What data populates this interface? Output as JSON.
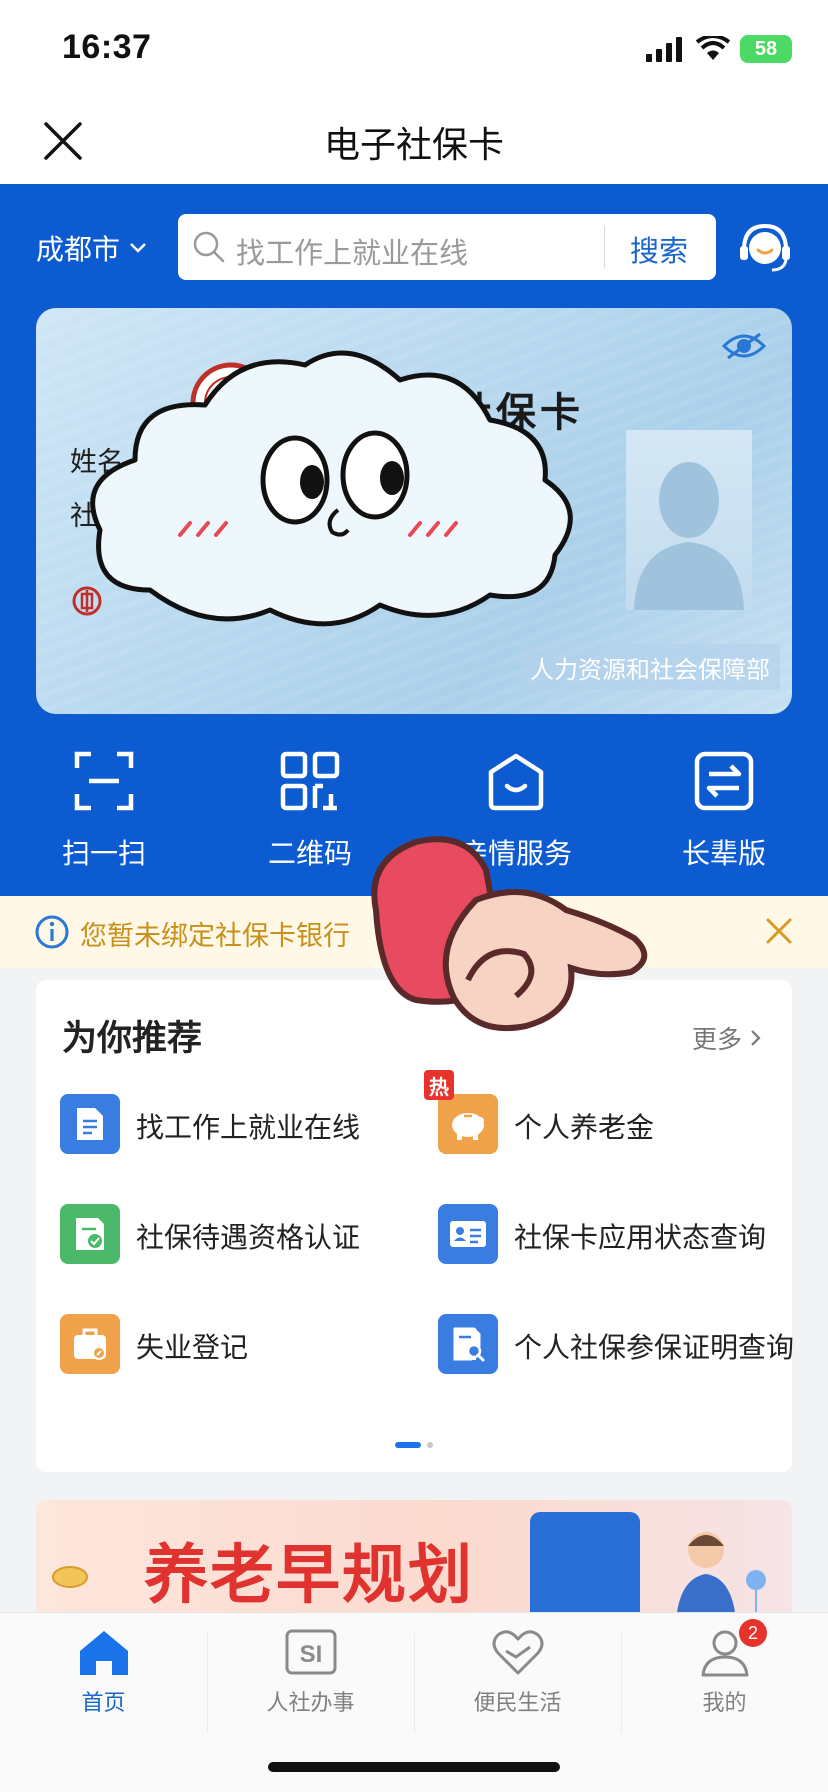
{
  "status_bar": {
    "time": "16:37",
    "battery": "58"
  },
  "nav": {
    "title": "电子社保卡",
    "close_icon": "close-icon"
  },
  "header": {
    "city": "成都市",
    "search": {
      "placeholder": "找工作上就业在线",
      "button": "搜索"
    },
    "service_icon": "customer-service-icon"
  },
  "card": {
    "title": "社保卡",
    "name_label": "姓名",
    "field2_label": "社会",
    "bank_label": "中国",
    "issuer": "人力资源和社会保障部"
  },
  "quick_actions": [
    {
      "label": "扫一扫",
      "icon": "scan-icon"
    },
    {
      "label": "二维码",
      "icon": "qrcode-icon"
    },
    {
      "label": "亲情服务",
      "icon": "family-service-icon"
    },
    {
      "label": "长辈版",
      "icon": "elder-mode-icon"
    }
  ],
  "notice": {
    "text": "您暂未绑定社保卡银行"
  },
  "recommend": {
    "title": "为你推荐",
    "more": "更多",
    "hot_badge": "热",
    "items": [
      {
        "label": "找工作上就业在线",
        "icon": "document-icon",
        "color": "#3a7de0"
      },
      {
        "label": "个人养老金",
        "icon": "piggy-bank-icon",
        "color": "#f0a24a"
      },
      {
        "label": "社保待遇资格认证",
        "icon": "certify-icon",
        "color": "#4cb86a"
      },
      {
        "label": "社保卡应用状态查询",
        "icon": "id-card-icon",
        "color": "#3a7de0"
      },
      {
        "label": "失业登记",
        "icon": "briefcase-icon",
        "color": "#f0a24a"
      },
      {
        "label": "个人社保参保证明查询",
        "icon": "certificate-search-icon",
        "color": "#3a7de0"
      }
    ]
  },
  "banner": {
    "text": "养老早规划"
  },
  "tab_bar": {
    "items": [
      {
        "label": "首页",
        "icon": "home-icon",
        "active": true
      },
      {
        "label": "人社办事",
        "icon": "si-icon",
        "active": false
      },
      {
        "label": "便民生活",
        "icon": "heart-hands-icon",
        "active": false
      },
      {
        "label": "我的",
        "icon": "user-icon",
        "active": false,
        "badge": "2"
      }
    ]
  },
  "colors": {
    "primary_blue": "#0c5bd0",
    "accent_blue": "#1a66c9",
    "notice_orange": "#c8901a",
    "hot_red": "#e8322c"
  }
}
